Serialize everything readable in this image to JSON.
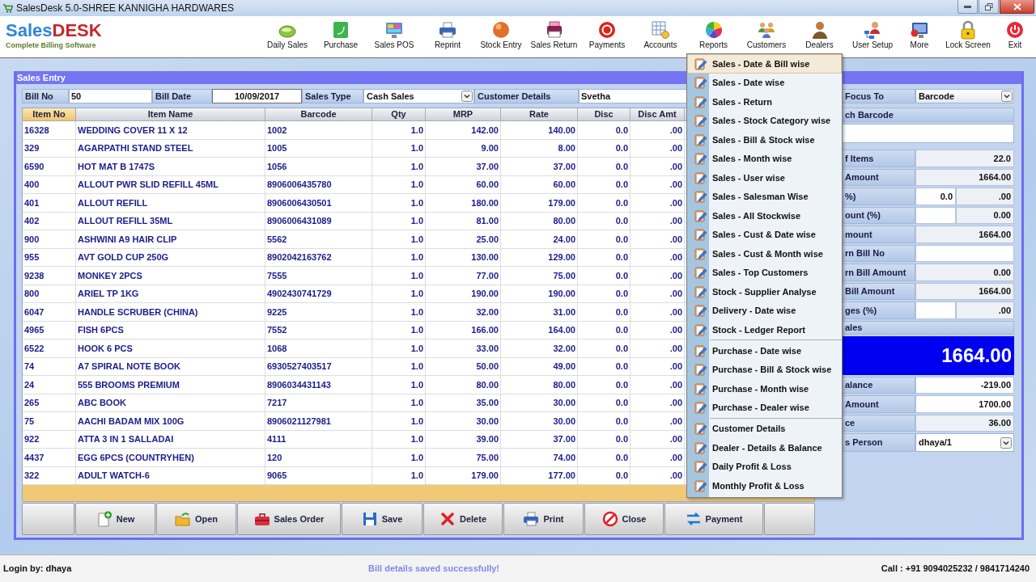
{
  "window": {
    "title": "SalesDesk 5.0-SHREE KANNIGHA HARDWARES"
  },
  "logo": {
    "text_parts": [
      "Sales",
      "DESK"
    ],
    "tagline": "Complete Billing Software"
  },
  "toolbar": [
    {
      "label": "Daily Sales"
    },
    {
      "label": "Purchase"
    },
    {
      "label": "Sales POS"
    },
    {
      "label": "Reprint"
    },
    {
      "label": "Stock Entry"
    },
    {
      "label": "Sales Return"
    },
    {
      "label": "Payments"
    },
    {
      "label": "Accounts"
    },
    {
      "label": "Reports"
    },
    {
      "label": "Customers"
    },
    {
      "label": "Dealers"
    },
    {
      "label": "User Setup"
    },
    {
      "label": "More"
    },
    {
      "label": "Lock Screen"
    },
    {
      "label": "Exit"
    }
  ],
  "panel": {
    "title": "Sales Entry"
  },
  "bill_fields": [
    {
      "label": "Bill No",
      "kind": "text",
      "value": "50"
    },
    {
      "label": "Bill Date",
      "kind": "date",
      "value": "10/09/2017"
    },
    {
      "label": "Sales Type",
      "kind": "select",
      "value": "Cash Sales"
    },
    {
      "label": "Customer Details",
      "kind": "text",
      "value": "Svetha"
    }
  ],
  "table": {
    "columns": [
      {
        "label": "Item No",
        "selected": true
      },
      {
        "label": "Item Name",
        "selected": false
      },
      {
        "label": "Barcode",
        "selected": false
      },
      {
        "label": "Qty",
        "selected": false
      },
      {
        "label": "MRP",
        "selected": false
      },
      {
        "label": "Rate",
        "selected": false
      },
      {
        "label": "Disc",
        "selected": false
      },
      {
        "label": "Disc Amt",
        "selected": false
      }
    ],
    "rows": [
      [
        "16328",
        "WEDDING COVER 11 X 12",
        "1002",
        "1.0",
        "142.00",
        "140.00",
        "0.0",
        ".00"
      ],
      [
        "329",
        "AGARPATHI STAND STEEL",
        "1005",
        "1.0",
        "9.00",
        "8.00",
        "0.0",
        ".00"
      ],
      [
        "6590",
        "HOT MAT B 1747S",
        "1056",
        "1.0",
        "37.00",
        "37.00",
        "0.0",
        ".00"
      ],
      [
        "400",
        "ALLOUT PWR SLID REFILL 45ML",
        "8906006435780",
        "1.0",
        "60.00",
        "60.00",
        "0.0",
        ".00"
      ],
      [
        "401",
        "ALLOUT REFILL",
        "8906006430501",
        "1.0",
        "180.00",
        "179.00",
        "0.0",
        ".00"
      ],
      [
        "402",
        "ALLOUT REFILL 35ML",
        "8906006431089",
        "1.0",
        "81.00",
        "80.00",
        "0.0",
        ".00"
      ],
      [
        "900",
        "ASHWINI A9 HAIR CLIP",
        "5562",
        "1.0",
        "25.00",
        "24.00",
        "0.0",
        ".00"
      ],
      [
        "955",
        "AVT GOLD CUP 250G",
        "8902042163762",
        "1.0",
        "130.00",
        "129.00",
        "0.0",
        ".00"
      ],
      [
        "9238",
        "MONKEY 2PCS",
        "7555",
        "1.0",
        "77.00",
        "75.00",
        "0.0",
        ".00"
      ],
      [
        "800",
        "ARIEL TP 1KG",
        "4902430741729",
        "1.0",
        "190.00",
        "190.00",
        "0.0",
        ".00"
      ],
      [
        "6047",
        "HANDLE SCRUBER (CHINA)",
        "9225",
        "1.0",
        "32.00",
        "31.00",
        "0.0",
        ".00"
      ],
      [
        "4965",
        "FISH 6PCS",
        "7552",
        "1.0",
        "166.00",
        "164.00",
        "0.0",
        ".00"
      ],
      [
        "6522",
        "HOOK 6 PCS",
        "1068",
        "1.0",
        "33.00",
        "32.00",
        "0.0",
        ".00"
      ],
      [
        "74",
        "A7 SPIRAL NOTE BOOK",
        "6930527403517",
        "1.0",
        "50.00",
        "49.00",
        "0.0",
        ".00"
      ],
      [
        "24",
        "555 BROOMS PREMIUM",
        "8906034431143",
        "1.0",
        "80.00",
        "80.00",
        "0.0",
        ".00"
      ],
      [
        "265",
        "ABC BOOK",
        "7217",
        "1.0",
        "35.00",
        "30.00",
        "0.0",
        ".00"
      ],
      [
        "75",
        "AACHI BADAM MIX 100G",
        "8906021127981",
        "1.0",
        "30.00",
        "30.00",
        "0.0",
        ".00"
      ],
      [
        "922",
        "ATTA 3 IN 1 SALLADAI",
        "4111",
        "1.0",
        "39.00",
        "37.00",
        "0.0",
        ".00"
      ],
      [
        "4437",
        "EGG 6PCS (COUNTRYHEN)",
        "120",
        "1.0",
        "75.00",
        "74.00",
        "0.0",
        ".00"
      ],
      [
        "322",
        "ADULT WATCH-6",
        "9065",
        "1.0",
        "179.00",
        "177.00",
        "0.0",
        ".00"
      ]
    ]
  },
  "buttons": [
    {
      "kind": "blank"
    },
    {
      "kind": "action",
      "label": "New"
    },
    {
      "kind": "action",
      "label": "Open"
    },
    {
      "kind": "action",
      "label": "Sales Order"
    },
    {
      "kind": "action",
      "label": "Save"
    },
    {
      "kind": "action",
      "label": "Delete"
    },
    {
      "kind": "action",
      "label": "Print"
    },
    {
      "kind": "action",
      "label": "Close"
    },
    {
      "kind": "action",
      "label": "Payment"
    },
    {
      "kind": "blank"
    }
  ],
  "side_panel": {
    "focus": {
      "label": "Focus To",
      "value": "Barcode"
    },
    "search": {
      "label": "ch Barcode"
    },
    "rows": [
      {
        "kind": "value",
        "label": "f Items",
        "value": "22.0"
      },
      {
        "kind": "value",
        "label": "Amount",
        "value": "1664.00"
      },
      {
        "kind": "pair",
        "label": "%)",
        "first": "0.0",
        "second": ".00"
      },
      {
        "kind": "pair",
        "label": "ount (%)",
        "second": "0.00"
      },
      {
        "kind": "value",
        "label": "mount",
        "value": "1664.00"
      },
      {
        "kind": "input",
        "label": "rn Bill No"
      },
      {
        "kind": "value",
        "label": "rn Bill Amount",
        "value": "0.00"
      },
      {
        "kind": "value",
        "label": "Bill Amount",
        "value": "1664.00"
      },
      {
        "kind": "pair",
        "label": "ges (%)",
        "second": ".00"
      },
      {
        "kind": "header",
        "label": "ales"
      },
      {
        "kind": "total",
        "value": "1664.00"
      },
      {
        "kind": "entry",
        "label": "alance",
        "value": "-219.00"
      },
      {
        "kind": "entry",
        "label": "Amount",
        "value": "1700.00"
      },
      {
        "kind": "value",
        "label": "ce",
        "value": "36.00"
      },
      {
        "kind": "select",
        "label": "s Person",
        "value": "dhaya/1"
      }
    ]
  },
  "reports_menu": [
    {
      "items": [
        {
          "label": "Sales - Date & Bill wise",
          "selected": true
        },
        {
          "label": "Sales - Date wise",
          "selected": false
        },
        {
          "label": "Sales - Return",
          "selected": false
        },
        {
          "label": "Sales - Stock Category wise",
          "selected": false
        },
        {
          "label": "Sales - Bill & Stock wise",
          "selected": false
        },
        {
          "label": "Sales - Month wise",
          "selected": false
        },
        {
          "label": "Sales - User wise",
          "selected": false
        },
        {
          "label": "Sales - Salesman Wise",
          "selected": false
        },
        {
          "label": "Sales - All Stockwise",
          "selected": false
        },
        {
          "label": "Sales - Cust & Date wise",
          "selected": false
        },
        {
          "label": "Sales - Cust & Month wise",
          "selected": false
        },
        {
          "label": "Sales - Top Customers",
          "selected": false
        },
        {
          "label": "Stock - Supplier Analyse",
          "selected": false
        },
        {
          "label": "Delivery - Date wise",
          "selected": false
        },
        {
          "label": "Stock - Ledger Report",
          "selected": false
        }
      ]
    },
    {
      "items": [
        {
          "label": "Purchase - Date wise",
          "selected": false
        },
        {
          "label": "Purchase - Bill & Stock wise",
          "selected": false
        },
        {
          "label": "Purchase - Month wise",
          "selected": false
        },
        {
          "label": "Purchase - Dealer wise",
          "selected": false
        }
      ]
    },
    {
      "items": [
        {
          "label": "Customer Details",
          "selected": false
        },
        {
          "label": "Dealer - Details & Balance",
          "selected": false
        },
        {
          "label": "Daily Profit & Loss",
          "selected": false
        },
        {
          "label": "Monthly Profit & Loss",
          "selected": false
        }
      ]
    }
  ],
  "status_bar": {
    "login": "Login by: dhaya",
    "message": "Bill details saved successfully!",
    "contact": "Call : +91 9094025232 / 9841714240"
  }
}
